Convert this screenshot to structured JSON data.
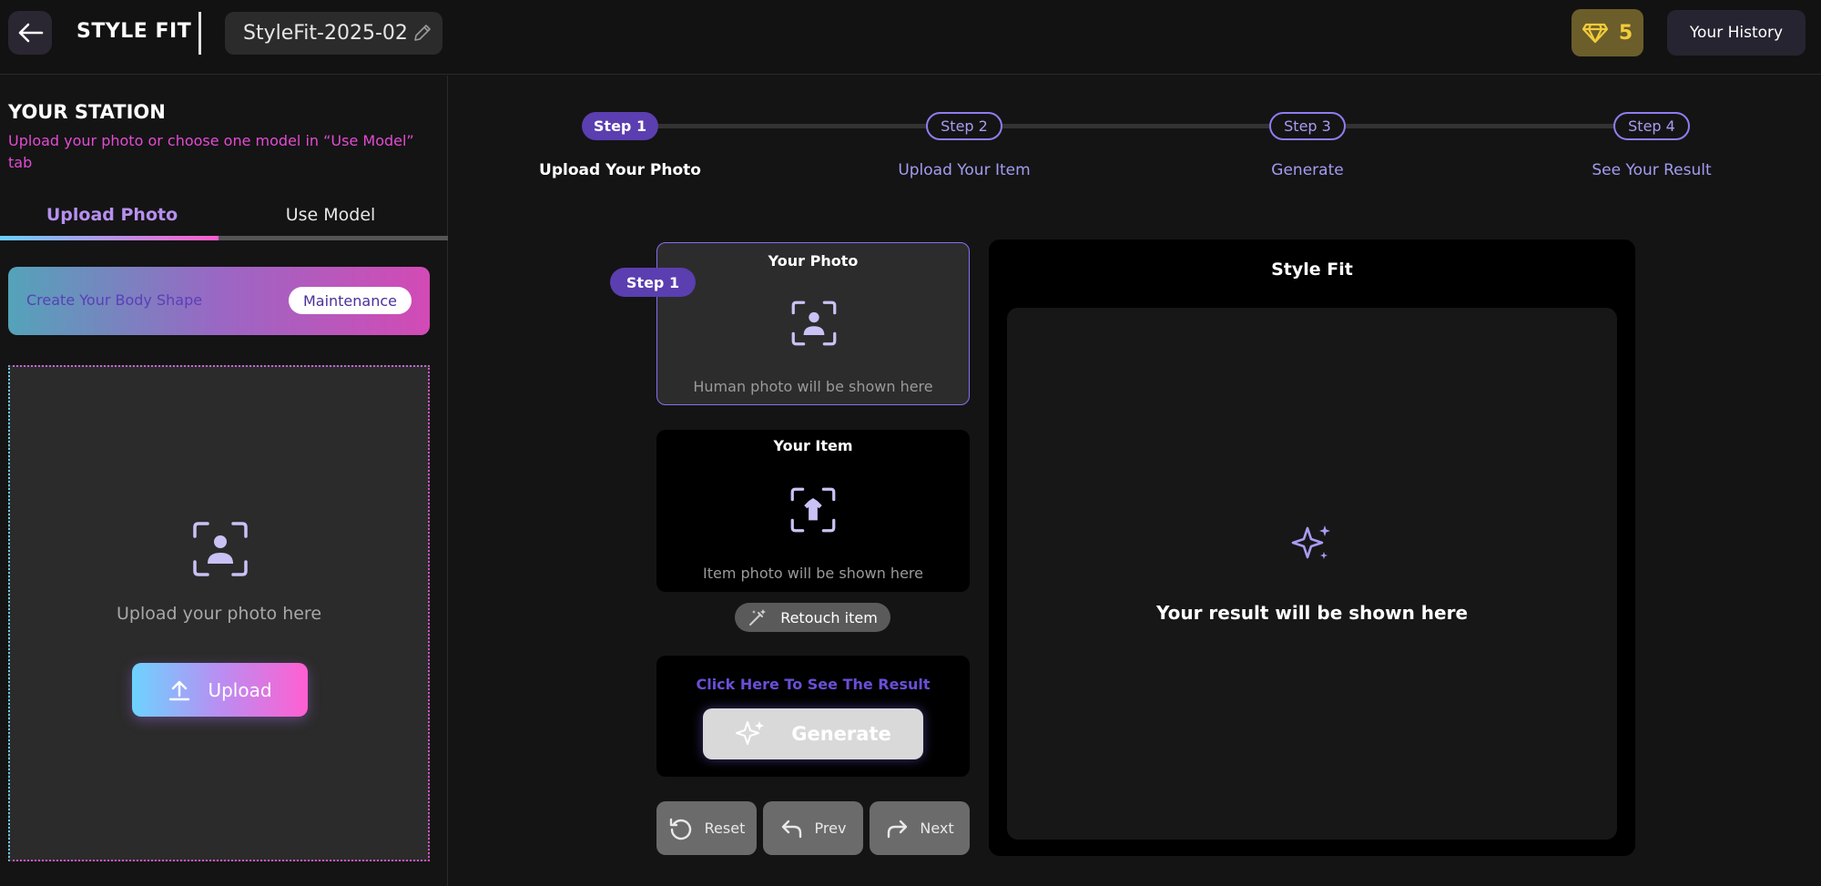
{
  "header": {
    "brand": "STYLE FIT",
    "project_name": "StyleFit-2025-02",
    "gem_count": "5",
    "history_label": "Your History"
  },
  "sidebar": {
    "title": "YOUR STATION",
    "subtitle": "Upload your photo or choose one model in “Use Model” tab",
    "tabs": [
      {
        "label": "Upload Photo",
        "active": true
      },
      {
        "label": "Use Model",
        "active": false
      }
    ],
    "body_shape_label": "Create Your Body Shape",
    "body_shape_badge": "Maintenance",
    "drop_text": "Upload your photo here",
    "upload_label": "Upload"
  },
  "stepper": {
    "steps": [
      {
        "pill": "Step 1",
        "label": "Upload Your Photo",
        "active": true
      },
      {
        "pill": "Step 2",
        "label": "Upload Your Item",
        "active": false
      },
      {
        "pill": "Step 3",
        "label": "Generate",
        "active": false
      },
      {
        "pill": "Step 4",
        "label": "See Your Result",
        "active": false
      }
    ]
  },
  "workspace": {
    "photo_card": {
      "title": "Your Photo",
      "hint": "Human photo will be shown here",
      "tag": "Step 1"
    },
    "item_card": {
      "title": "Your Item",
      "hint": "Item photo will be shown here"
    },
    "retouch_label": "Retouch item",
    "generate_hint": "Click Here To See The Result",
    "generate_label": "Generate",
    "controls": {
      "reset": "Reset",
      "prev": "Prev",
      "next": "Next"
    }
  },
  "result": {
    "title": "Style Fit",
    "placeholder": "Your result will be shown here"
  },
  "colors": {
    "accent_purple": "#5b3eb0",
    "accent_pink": "#e34bd4",
    "accent_cyan": "#6ad0ff",
    "gem_gold": "#f2cc3a"
  }
}
